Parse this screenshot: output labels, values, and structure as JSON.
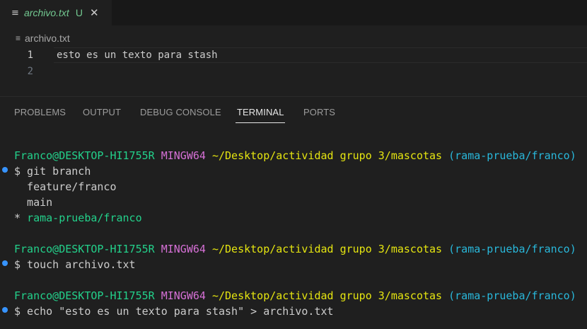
{
  "tab": {
    "icon": "lines-file-icon",
    "name": "archivo.txt",
    "status": "U",
    "close": "✕",
    "color": "#73c991"
  },
  "breadcrumb": {
    "icon": "lines-file-icon",
    "file": "archivo.txt"
  },
  "editor": {
    "lines": [
      {
        "number": "1",
        "text": "esto es un texto para stash"
      },
      {
        "number": "2",
        "text": ""
      }
    ]
  },
  "panel": {
    "tabs": [
      "PROBLEMS",
      "OUTPUT",
      "DEBUG CONSOLE",
      "TERMINAL",
      "PORTS"
    ],
    "active_tab": "TERMINAL"
  },
  "terminal": {
    "prompt_user": "Franco@DESKTOP-HI1755R",
    "prompt_env": "MINGW64",
    "prompt_path": "~/Desktop/actividad grupo 3/mascotas",
    "prompt_branch": "(rama-prueba/franco)",
    "cmd1": "$ git branch",
    "out1": "  feature/franco",
    "out2": "  main",
    "out3_star": "* ",
    "out3_branch": "rama-prueba/franco",
    "cmd2": "$ touch archivo.txt",
    "cmd3": "$ echo \"esto es un texto para stash\" > archivo.txt"
  }
}
